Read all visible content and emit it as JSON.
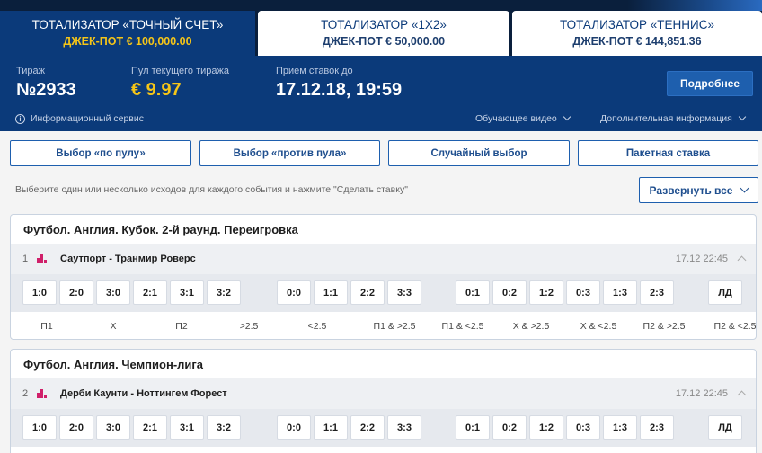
{
  "tabs": [
    {
      "title": "ТОТАЛИЗАТОР «ТОЧНЫЙ СЧЕТ»",
      "jackpot": "ДЖЕК-ПОТ € 100,000.00"
    },
    {
      "title": "ТОТАЛИЗАТОР «1Х2»",
      "jackpot": "ДЖЕК-ПОТ € 50,000.00"
    },
    {
      "title": "ТОТАЛИЗАТОР «ТЕННИС»",
      "jackpot": "ДЖЕК-ПОТ € 144,851.36"
    }
  ],
  "panel": {
    "draw_label": "Тираж",
    "draw_value": "№2933",
    "pool_label": "Пул текущего тиража",
    "pool_value": "€ 9.97",
    "deadline_label": "Прием ставок до",
    "deadline_value": "17.12.18, 19:59",
    "details_button": "Подробнее",
    "info_service": "Информационный сервис",
    "training_video": "Обучающее видео",
    "additional_info": "Дополнительная информация"
  },
  "selection_buttons": [
    "Выбор «по пулу»",
    "Выбор «против пула»",
    "Случайный выбор",
    "Пакетная ставка"
  ],
  "hint": "Выберите один или несколько исходов для каждого события и нажмите \"Сделать ставку\"",
  "expand_button": "Развернуть все",
  "events": [
    {
      "league": "Футбол. Англия. Кубок. 2-й раунд. Переигровка",
      "num": "1",
      "teams": "Саутпорт - Транмир Роверс",
      "time": "17.12 22:45"
    },
    {
      "league": "Футбол. Англия. Чемпион-лига",
      "num": "2",
      "teams": "Дерби Каунти - Ноттингем Форест",
      "time": "17.12 22:45"
    }
  ],
  "scores": [
    "1:0",
    "2:0",
    "3:0",
    "2:1",
    "3:1",
    "3:2",
    "0:0",
    "1:1",
    "2:2",
    "3:3",
    "0:1",
    "0:2",
    "1:2",
    "0:3",
    "1:3",
    "2:3",
    "ЛД"
  ],
  "outcome_labels": [
    "П1",
    "Х",
    "П2",
    ">2.5",
    "<2.5",
    "П1 & >2.5",
    "П1 & <2.5",
    "Х & >2.5",
    "Х & <2.5",
    "П2 & >2.5",
    "П2 & <2.5"
  ]
}
